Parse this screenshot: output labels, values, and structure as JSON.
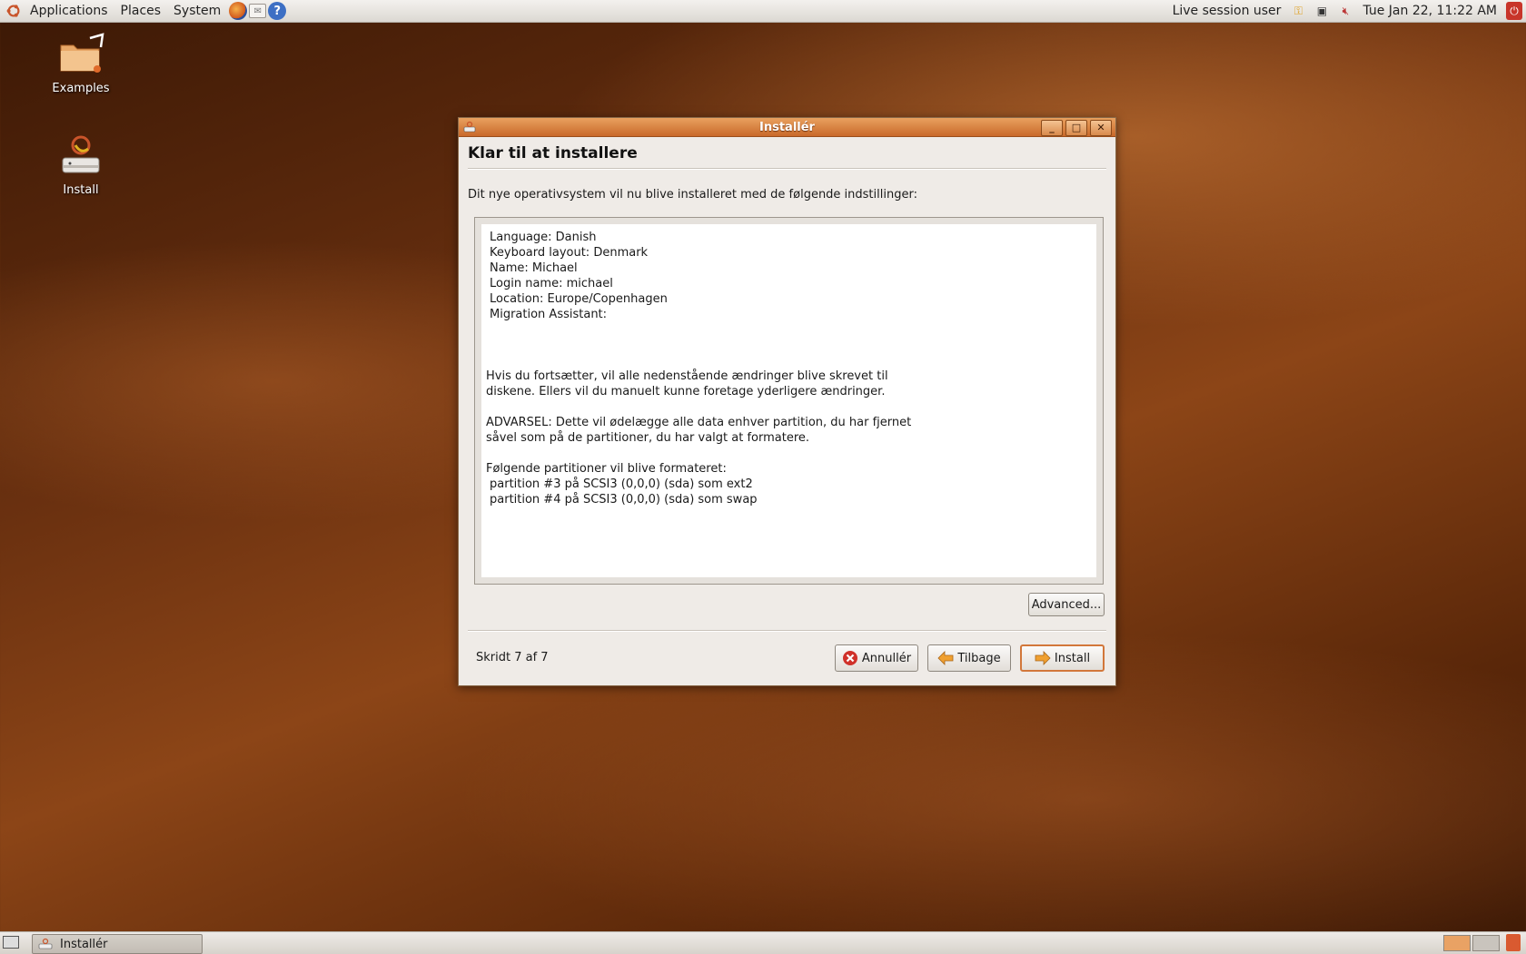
{
  "top_panel": {
    "menus": [
      "Applications",
      "Places",
      "System"
    ],
    "launchers": [
      "firefox-icon",
      "mail-icon",
      "help-icon"
    ],
    "user": "Live session user",
    "clock": "Tue Jan 22, 11:22 AM"
  },
  "desktop": {
    "icons": [
      {
        "label": "Examples",
        "icon": "folder-icon"
      },
      {
        "label": "Install",
        "icon": "installer-icon"
      }
    ]
  },
  "window": {
    "title": "Installér",
    "heading": "Klar til at installere",
    "intro": "Dit nye operativsystem vil nu blive installeret med de følgende indstillinger:",
    "settings": [
      "Language: Danish",
      "Keyboard layout: Denmark",
      "Name: Michael",
      "Login name: michael",
      "Location: Europe/Copenhagen",
      "Migration Assistant:"
    ],
    "notice": [
      "Hvis du fortsætter, vil alle nedenstående ændringer blive skrevet til",
      "diskene. Ellers vil du manuelt kunne foretage yderligere ændringer."
    ],
    "warning": [
      "ADVARSEL: Dette vil ødelægge alle data enhver partition, du har fjernet",
      "såvel som på de partitioner, du har valgt at formatere."
    ],
    "partitions_header": "Følgende partitioner vil blive formateret:",
    "partitions": [
      "partition #3 på SCSI3 (0,0,0) (sda) som ext2",
      "partition #4 på SCSI3 (0,0,0) (sda) som swap"
    ],
    "advanced_label": "Advanced...",
    "step": "Skridt 7 af 7",
    "cancel_label": "Annullér",
    "back_label": "Tilbage",
    "install_label": "Install"
  },
  "bottom_panel": {
    "task_label": "Installér"
  },
  "colors": {
    "accent": "#d2773a",
    "titlebar": "#c9692a"
  }
}
